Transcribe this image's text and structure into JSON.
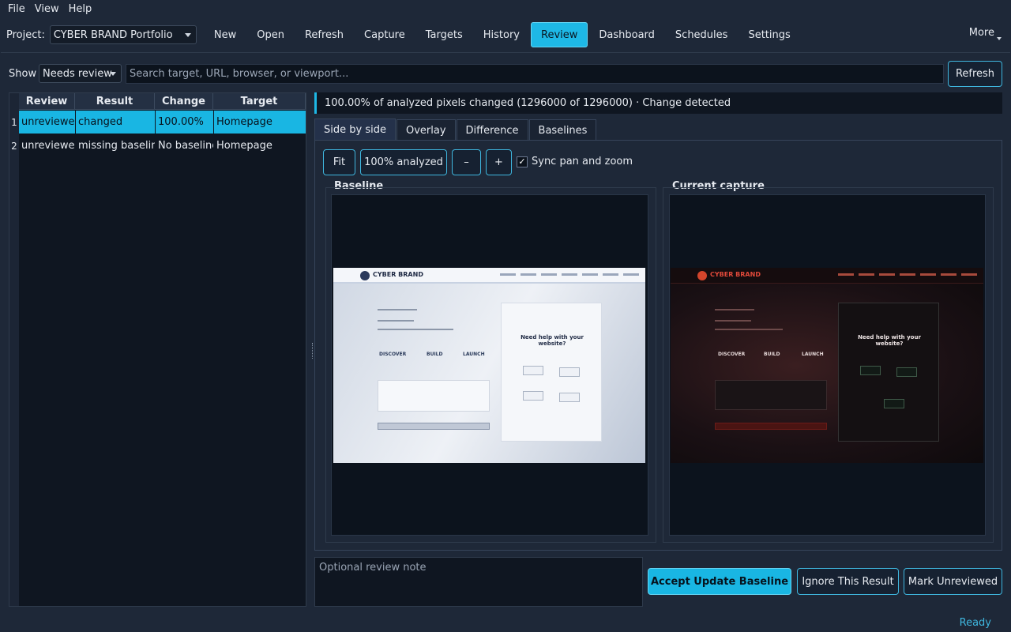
{
  "menu": {
    "items": [
      {
        "label": "File"
      },
      {
        "label": "View"
      },
      {
        "label": "Help"
      }
    ]
  },
  "toolbar": {
    "project_label": "Project:",
    "project_value": "CYBER BRAND Portfolio",
    "buttons": [
      {
        "label": "New"
      },
      {
        "label": "Open"
      },
      {
        "label": "Refresh"
      },
      {
        "label": "Capture"
      },
      {
        "label": "Targets"
      },
      {
        "label": "History"
      },
      {
        "label": "Review"
      },
      {
        "label": "Dashboard"
      },
      {
        "label": "Schedules"
      },
      {
        "label": "Settings"
      }
    ],
    "active": "Review",
    "more_label": "More"
  },
  "filter": {
    "show_label": "Show",
    "show_value": "Needs review",
    "search_placeholder": "Search target, URL, browser, or viewport...",
    "refresh_label": "Refresh"
  },
  "results": {
    "columns": [
      "Review",
      "Result",
      "Change",
      "Target"
    ],
    "rows": [
      {
        "num": "1",
        "review": "unreviewed",
        "result": "changed",
        "change": "100.00%",
        "target": "Homepage"
      },
      {
        "num": "2",
        "review": "unreviewed",
        "result": "missing baseline",
        "change": "No baseline",
        "target": "Homepage"
      }
    ],
    "selected_row": 0
  },
  "detail": {
    "summary": "100.00% of analyzed pixels changed (1296000 of 1296000) · Change detected",
    "tabs": [
      {
        "label": "Side by side"
      },
      {
        "label": "Overlay"
      },
      {
        "label": "Difference"
      },
      {
        "label": "Baselines"
      }
    ],
    "active_tab": "Side by side",
    "controls": {
      "fit": "Fit",
      "zoom": "100% analyzed",
      "zoom_out": "–",
      "zoom_in": "+",
      "sync_label": "Sync pan and zoom",
      "sync_checked": "✓"
    },
    "baseline_title": "Baseline",
    "current_title": "Current capture"
  },
  "screenshot_mock": {
    "brand": "CYBER BRAND",
    "steps": [
      "DISCOVER",
      "BUILD",
      "LAUNCH"
    ],
    "help_heading": "Need help with your website?",
    "colors": {
      "baseline_bg": "#dfe5ee",
      "current_bg": "#1a1014",
      "current_accent": "#d3452c"
    }
  },
  "review": {
    "note_placeholder": "Optional review note",
    "accept_label": "Accept  Update Baseline",
    "ignore_label": "Ignore This Result",
    "unreview_label": "Mark Unreviewed"
  },
  "status": {
    "text": "Ready"
  },
  "colors": {
    "accent": "#1eb8e6",
    "background": "#1e2838",
    "panel": "#0f1621"
  }
}
